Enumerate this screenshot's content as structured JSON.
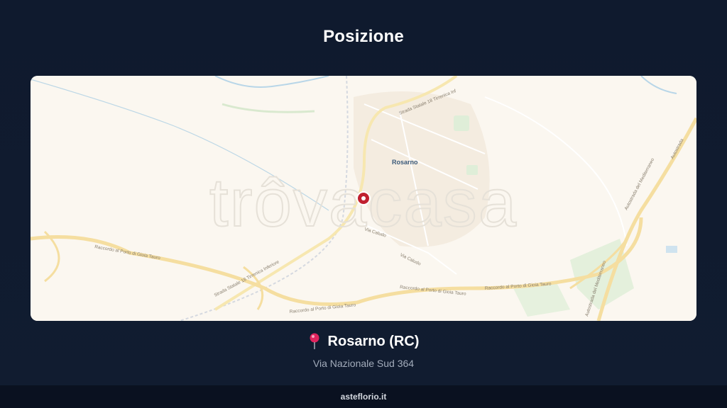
{
  "header": {
    "title": "Posizione"
  },
  "map": {
    "labels": {
      "town": "Rosarno",
      "road_ss18_top": "Strada Statale 18 Tirrenica Inf",
      "road_ss18_bottom": "Strada Statale 18 Tirrenica Inferiore",
      "raccordo_1": "Raccordo al Porto di Gioia Tauro",
      "raccordo_2": "Raccordo al Porto di Gioia Tauro",
      "raccordo_3": "Raccordo al Porto di Gioia Tauro",
      "raccordo_4": "Raccordo al Porto di Gioia Tauro",
      "via_caludo_1": "Via Caludo",
      "via_caludo_2": "Via Caludo",
      "autostrada_1": "Autostrada del Mediterraneo",
      "autostrada_2": "Autostrada del Mediterraneo",
      "autostrada_3": "Autostrada"
    },
    "watermark": "trôvacasa",
    "marker_color": "#c0202f"
  },
  "location": {
    "pin_icon": "round-pushpin-icon",
    "city": "Rosarno (RC)",
    "address": "Via Nazionale Sud 364"
  },
  "footer": {
    "site": "asteflorio.it"
  }
}
